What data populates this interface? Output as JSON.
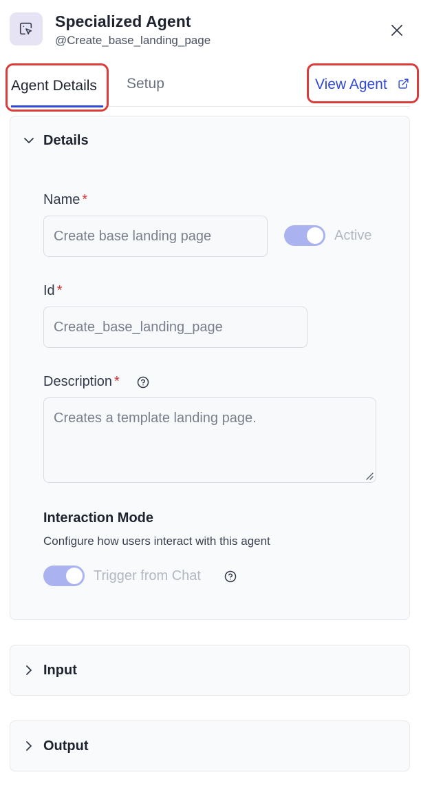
{
  "header": {
    "title": "Specialized Agent",
    "subtitle": "@Create_base_landing_page",
    "icon": "pointer-select-icon",
    "close_icon": "close-icon"
  },
  "tabs": {
    "agent_details": "Agent Details",
    "setup": "Setup",
    "view_agent": "View Agent",
    "view_agent_icon": "external-link-icon"
  },
  "details": {
    "title": "Details",
    "name_label": "Name",
    "name_value": "Create base landing page",
    "active_label": "Active",
    "id_label": "Id",
    "id_value": "Create_base_landing_page",
    "description_label": "Description",
    "description_value": "Creates a template landing page.",
    "required_mark": "*",
    "interaction_title": "Interaction Mode",
    "interaction_desc": "Configure how users interact with this agent",
    "trigger_label": "Trigger from Chat"
  },
  "input": {
    "title": "Input"
  },
  "output": {
    "title": "Output"
  },
  "colors": {
    "accent": "#2f48d6",
    "highlight": "#dc3b3b",
    "toggle": "#aab3f0",
    "required": "#d13232"
  }
}
